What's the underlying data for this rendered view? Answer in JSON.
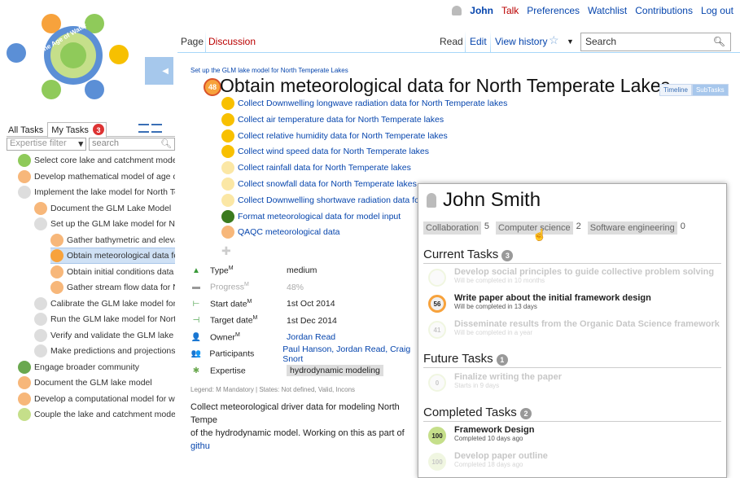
{
  "personal_bar": {
    "user": "John",
    "talk": "Talk",
    "preferences": "Preferences",
    "watchlist": "Watchlist",
    "contributions": "Contributions",
    "logout": "Log out"
  },
  "logo": {
    "text": "The Age of Water"
  },
  "left": {
    "tab_all": "All Tasks",
    "tab_my": "My Tasks",
    "my_count": "3",
    "filter": "Expertise filter",
    "search": "search",
    "tree": [
      {
        "label": "Select core lake and catchment models",
        "color": "#8fca5a"
      },
      {
        "label": "Develop mathematical model of age of wa",
        "color": "#f7b77a"
      },
      {
        "label": "Implement the lake model for North Temp",
        "color": "#ddd"
      },
      {
        "label": "Document the GLM Lake Model",
        "color": "#f7b77a"
      },
      {
        "label": "Set up the GLM lake model for North",
        "color": "#ddd"
      },
      {
        "label": "Gather bathymetric and elevatic",
        "color": "#f7b77a"
      },
      {
        "label": "Obtain meteorological data for N",
        "color": "#f7a23c"
      },
      {
        "label": "Obtain initial conditions data for",
        "color": "#f7b77a"
      },
      {
        "label": "Gather stream flow data for Nor",
        "color": "#f7b77a"
      },
      {
        "label": "Calibrate the GLM lake model for No",
        "color": "#ddd"
      },
      {
        "label": "Run the GLM lake model for North T",
        "color": "#ddd"
      },
      {
        "label": "Verify and validate the GLM lake mo",
        "color": "#ddd"
      },
      {
        "label": "Make predictions and projections to",
        "color": "#ddd"
      },
      {
        "label": "Engage broader community",
        "color": "#6aa84f"
      },
      {
        "label": "Document the GLM lake model",
        "color": "#f7b77a"
      },
      {
        "label": "Develop a computational model for water",
        "color": "#f7b77a"
      },
      {
        "label": "Couple the lake and catchment models",
        "color": "#c5df8a"
      }
    ]
  },
  "page_tabs": {
    "page": "Page",
    "discussion": "Discussion",
    "read": "Read",
    "edit": "Edit",
    "history": "View history",
    "search": "Search"
  },
  "article": {
    "breadcrumb": "Set up the GLM lake model for North Temperate Lakes",
    "progress": "48",
    "title": "Obtain meteorological data for North Temperate Lakes",
    "view_timeline": "Timeline",
    "view_subtasks": "SubTasks",
    "subtasks": [
      {
        "label": "Collect Downwelling longwave radiation data for North Temperate lakes",
        "color": "#f8c000"
      },
      {
        "label": "Collect air temperature data for North Temperate lakes",
        "color": "#f8c000"
      },
      {
        "label": "Collect relative humidity data for North Temperate lakes",
        "color": "#f8c000"
      },
      {
        "label": "Collect wind speed data for North Temperate lakes",
        "color": "#f8c000"
      },
      {
        "label": "Collect rainfall data for North Temperate lakes",
        "color": "#fbe7a5"
      },
      {
        "label": "Collect snowfall data for North Temperate lakes",
        "color": "#fbe7a5"
      },
      {
        "label": "Collect Downwelling shortwave radiation data for North",
        "color": "#fbe7a5"
      },
      {
        "label": "Format meteorological data for model input",
        "color": "#3b7a1e"
      },
      {
        "label": "QAQC meteorological data",
        "color": "#f7b77a"
      }
    ],
    "props": [
      {
        "key": "Type",
        "req": "M",
        "value": "medium"
      },
      {
        "key": "Progress",
        "req": "M",
        "value": "48%"
      },
      {
        "key": "Start date",
        "req": "M",
        "value": "1st Oct 2014"
      },
      {
        "key": "Target date",
        "req": "M",
        "value": "1st Dec 2014"
      },
      {
        "key": "Owner",
        "req": "M",
        "value": "Jordan Read"
      },
      {
        "key": "Participants",
        "req": "",
        "value": "Paul Hanson, Jordan Read, Craig Snort"
      },
      {
        "key": "Expertise",
        "req": "",
        "value": "hydrodynamic modeling"
      }
    ],
    "legend": "Legend: M Mandatory | States: Not defined, Valid, Incons",
    "desc1": "Collect meteorological driver data for modeling North Tempe",
    "desc2": "of the hydrodynamic model. Working on this as part of ",
    "desc_link": "githu"
  },
  "popup": {
    "name": "John Smith",
    "expertise": [
      {
        "label": "Collaboration",
        "count": "5"
      },
      {
        "label": "Computer science",
        "count": "2"
      },
      {
        "label": "Software engineering",
        "count": "0"
      }
    ],
    "current_title": "Current Tasks",
    "current_count": "3",
    "current": [
      {
        "title": "Develop social principles to guide collective problem solving",
        "sub": "Will be completed in 10 months",
        "pct": "",
        "fade": true
      },
      {
        "title": "Write paper about the initial framework design",
        "sub": "Will be completed in 13 days",
        "pct": "56",
        "fade": false
      },
      {
        "title": "Disseminate results from the Organic Data Science framework",
        "sub": "Will be completed in a year",
        "pct": "41",
        "fade": true
      }
    ],
    "future_title": "Future Tasks",
    "future_count": "1",
    "future": [
      {
        "title": "Finalize writing the paper",
        "sub": "Starts in 9 days",
        "pct": "0",
        "fade": true
      }
    ],
    "completed_title": "Completed Tasks",
    "completed_count": "2",
    "completed": [
      {
        "title": "Framework Design",
        "sub": "Completed 10 days ago",
        "pct": "100",
        "fade": false
      },
      {
        "title": "Develop paper outline",
        "sub": "Completed 18 days ago",
        "pct": "100",
        "fade": true
      }
    ]
  }
}
